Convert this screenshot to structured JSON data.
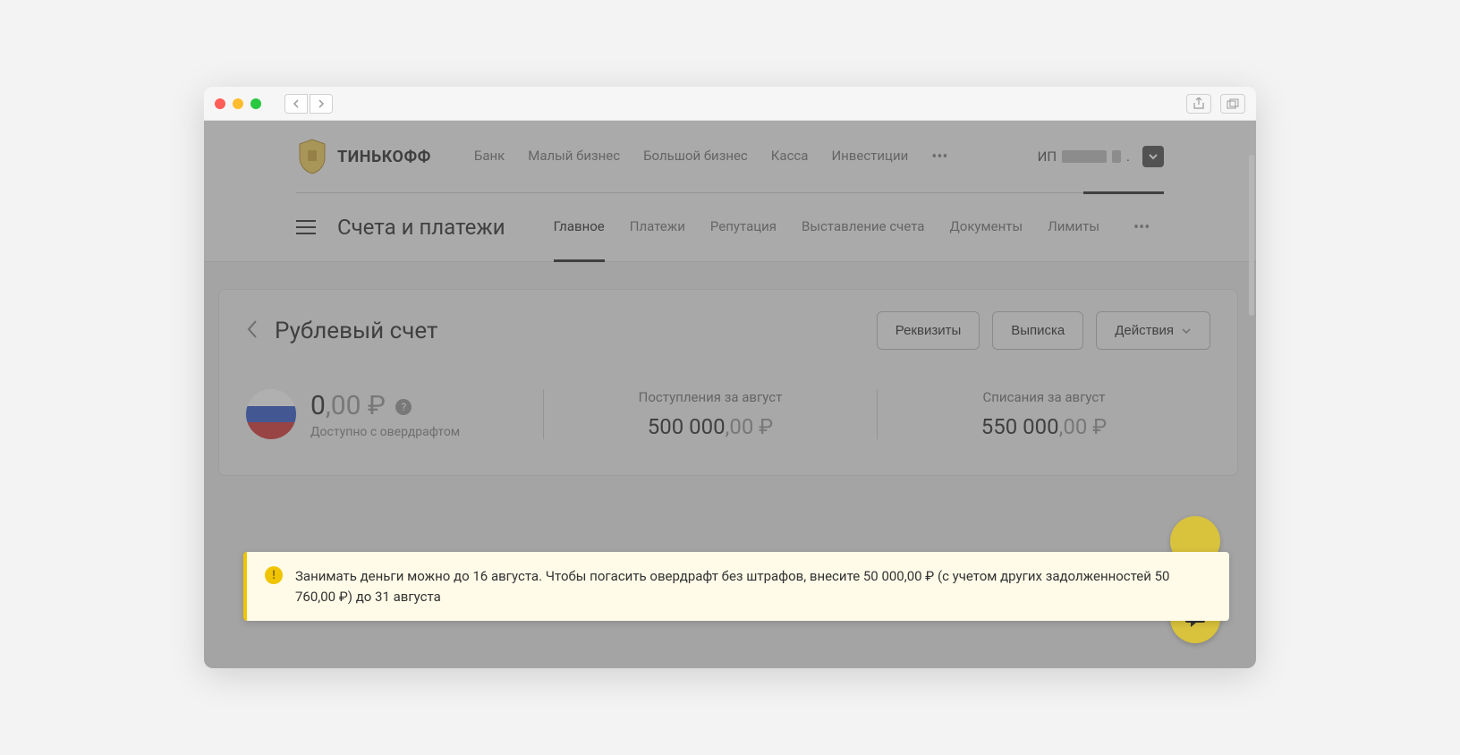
{
  "brand": "ТИНЬКОФФ",
  "main_nav": {
    "bank": "Банк",
    "small_biz": "Малый бизнес",
    "big_biz": "Большой бизнес",
    "kassa": "Касса",
    "invest": "Инвестиции"
  },
  "user": {
    "prefix": "ИП",
    "suffix": "."
  },
  "section_title": "Счета и платежи",
  "sub_nav": {
    "main": "Главное",
    "payments": "Платежи",
    "reputation": "Репутация",
    "invoice": "Выставление счета",
    "documents": "Документы",
    "limits": "Лимиты"
  },
  "account": {
    "title": "Рублевый счет",
    "actions": {
      "details": "Реквизиты",
      "statement": "Выписка",
      "menu": "Действия"
    },
    "balance": {
      "int": "0",
      "dec": ",00 ₽",
      "help": "?",
      "sub": "Доступно с овердрафтом"
    },
    "incoming": {
      "label": "Поступления за август",
      "int": "500 000",
      "dec": ",00 ₽"
    },
    "outgoing": {
      "label": "Списания за август",
      "int": "550 000",
      "dec": ",00 ₽"
    }
  },
  "alert": {
    "text": "Занимать деньги можно до 16 августа. Чтобы погасить овердрафт без штрафов, внесите 50 000,00 ₽ (с учетом других задолженностей 50 760,00 ₽) до 31 августа"
  }
}
